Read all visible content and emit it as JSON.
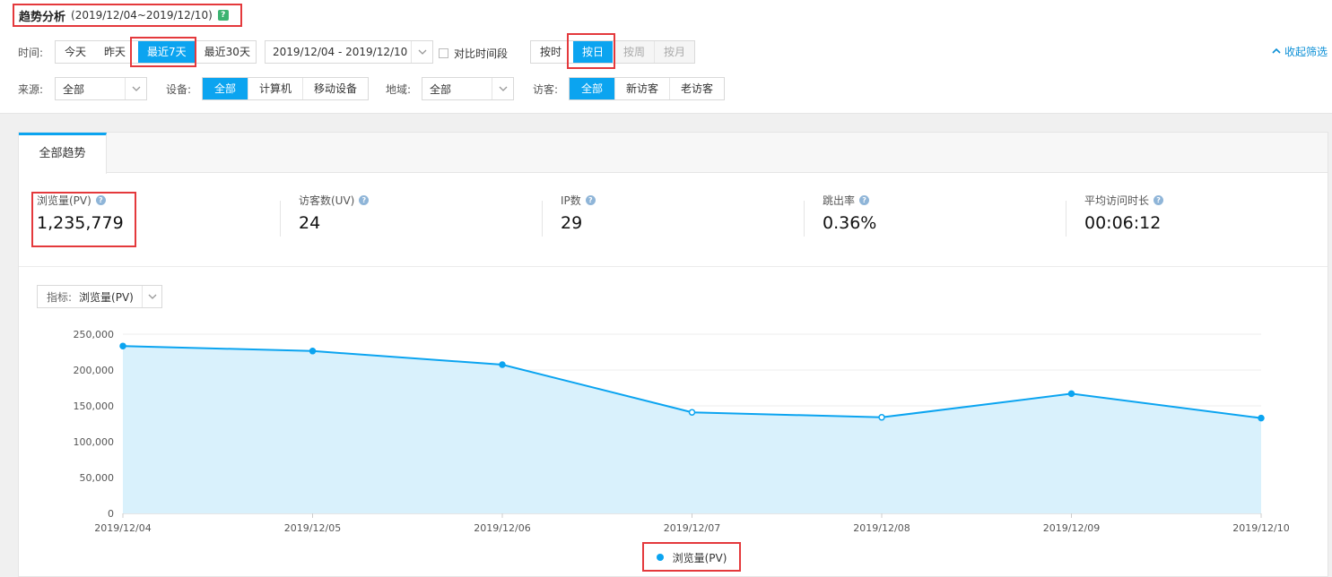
{
  "header": {
    "title": "趋势分析",
    "range": "(2019/12/04~2019/12/10)",
    "help_icon": "?"
  },
  "filters": {
    "time": {
      "label": "时间:",
      "options": [
        "今天",
        "昨天",
        "最近7天",
        "最近30天"
      ],
      "active": "最近7天"
    },
    "date_range": "2019/12/04 - 2019/12/10",
    "compare_label": "对比时间段",
    "granularity": {
      "options": [
        "按时",
        "按日",
        "按周",
        "按月"
      ],
      "active": "按日",
      "disabled": [
        "按周",
        "按月"
      ]
    },
    "collapse_label": "收起筛选",
    "source": {
      "label": "来源:",
      "value": "全部"
    },
    "device": {
      "label": "设备:",
      "options": [
        "全部",
        "计算机",
        "移动设备"
      ],
      "active": "全部"
    },
    "region": {
      "label": "地域:",
      "value": "全部"
    },
    "visitor": {
      "label": "访客:",
      "options": [
        "全部",
        "新访客",
        "老访客"
      ],
      "active": "全部"
    }
  },
  "tab": {
    "label": "全部趋势"
  },
  "metrics": [
    {
      "label": "浏览量(PV)",
      "value": "1,235,779"
    },
    {
      "label": "访客数(UV)",
      "value": "24"
    },
    {
      "label": "IP数",
      "value": "29"
    },
    {
      "label": "跳出率",
      "value": "0.36%"
    },
    {
      "label": "平均访问时长",
      "value": "00:06:12"
    }
  ],
  "indicator": {
    "label": "指标:",
    "value": "浏览量(PV)"
  },
  "colors": {
    "accent": "#0ba4f0",
    "area_fill": "#d9f1fc",
    "highlight": "#e4393c"
  },
  "chart_data": {
    "type": "area",
    "x": [
      "2019/12/04",
      "2019/12/05",
      "2019/12/06",
      "2019/12/07",
      "2019/12/08",
      "2019/12/09",
      "2019/12/10"
    ],
    "series": [
      {
        "name": "浏览量(PV)",
        "values": [
          233500,
          226500,
          207500,
          141000,
          134000,
          167000,
          133000
        ]
      }
    ],
    "ylim": [
      0,
      250000
    ],
    "yticks": [
      "250,000",
      "200,000",
      "150,000",
      "100,000",
      "50,000",
      "0"
    ],
    "ytick_values": [
      250000,
      200000,
      150000,
      100000,
      50000,
      0
    ],
    "grid": true,
    "legend": "bottom-center"
  }
}
